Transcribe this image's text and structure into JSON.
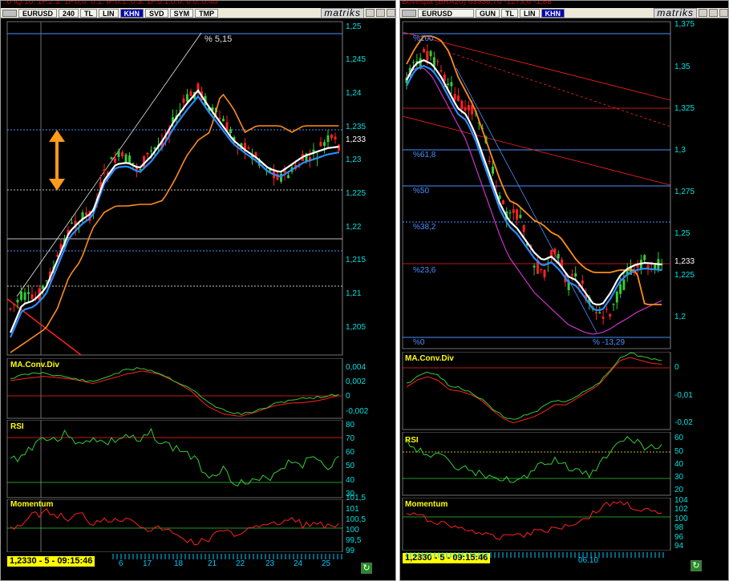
{
  "left": {
    "ticker_fragment": "..0 IQ.10. 1P.2.3. 1P.0,0. 0.1. IP.0.1..0.3. 1P.0.1.0.0. 0.0..0.40",
    "symbol": "EURUSD",
    "period": "240",
    "buttons": [
      "TL",
      "LIN",
      "KHN",
      "SVD",
      "SYM",
      "TMP"
    ],
    "active_button": "KHN",
    "brand": "matriks",
    "price_axis": [
      "1,25",
      "1,245",
      "1,24",
      "1,235",
      "1,233",
      "1,23",
      "1,225",
      "1,22",
      "1,215",
      "1,21",
      "1,205"
    ],
    "annotation": "% 5,15",
    "macd": {
      "label": "MA.Conv.Div",
      "axis": [
        "0,004",
        "0,002",
        "0",
        "-0,002"
      ]
    },
    "rsi": {
      "label": "RSI",
      "axis": [
        "80",
        "70",
        "60",
        "50",
        "40",
        "30"
      ]
    },
    "momentum": {
      "label": "Momentum",
      "axis": [
        "101,5",
        "101",
        "100,5",
        "100",
        "99,5",
        "99"
      ]
    },
    "status": "1,2330 - 5 - 09:15:46",
    "dates": [
      "6",
      "17",
      "18",
      "21",
      "22",
      "23",
      "24",
      "25"
    ]
  },
  "right": {
    "ticker_fragment": "Bovespa (BRA20)     63936,70   -1273,6   -1,88",
    "symbol": "EURUSD",
    "period": "GUN",
    "buttons": [
      "TL",
      "LIN",
      "KHN"
    ],
    "active_button": "KHN",
    "brand": "matriks",
    "price_axis": [
      "1,375",
      "1,35",
      "1,325",
      "1,3",
      "1,275",
      "1,25",
      "1,233",
      "1,225",
      "1,2"
    ],
    "fib_labels": [
      "%100",
      "%61,8",
      "%50",
      "%38,2",
      "%23,6",
      "%0",
      "% -13,29"
    ],
    "macd": {
      "label": "MA.Conv.Div",
      "axis": [
        "0",
        "-0,01",
        "-0,02"
      ]
    },
    "rsi": {
      "label": "RSI",
      "axis": [
        "60",
        "50",
        "40",
        "30",
        "20"
      ]
    },
    "momentum": {
      "label": "Momentum",
      "axis": [
        "104",
        "102",
        "100",
        "98",
        "96",
        "94"
      ]
    },
    "status": "1,2330 - 5 - 09:15:46",
    "dates": [
      "06.10"
    ]
  },
  "colors": {
    "background": "#000000",
    "up_candle": "#33cc33",
    "down_candle": "#ff2020",
    "ma_white": "#ffffff",
    "ma_blue": "#2a8cff",
    "envelope": "#ff8c1a",
    "axis_text": "#00e0e0",
    "label": "#ffff00",
    "fib": "#4a90ff"
  }
}
